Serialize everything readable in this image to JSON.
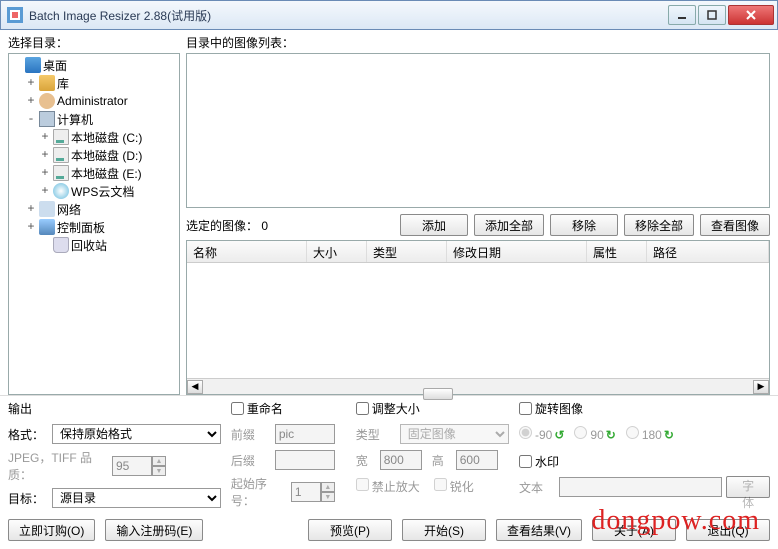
{
  "title": "Batch Image Resizer 2.88(试用版)",
  "labels": {
    "choose_dir": "选择目录：",
    "image_list": "目录中的图像列表：",
    "selected_images": "选定的图像：",
    "selected_count": "0",
    "output": "输出",
    "format": "格式：",
    "quality": "JPEG，TIFF 品质：",
    "target": "目标：",
    "rename": "重命名",
    "prefix": "前缀",
    "suffix": "后缀",
    "start_seq": "起始序号：",
    "resize": "调整大小",
    "type": "类型",
    "width": "宽",
    "height": "高",
    "no_enlarge": "禁止放大",
    "sharpen": "锐化",
    "rotate": "旋转图像",
    "watermark": "水印",
    "wm_text": "文本",
    "font": "字体"
  },
  "tree": {
    "n0": "桌面",
    "n1": "库",
    "n2": "Administrator",
    "n3": "计算机",
    "n3a": "本地磁盘 (C:)",
    "n3b": "本地磁盘 (D:)",
    "n3c": "本地磁盘 (E:)",
    "n3d": "WPS云文档",
    "n4": "网络",
    "n5": "控制面板",
    "n6": "回收站"
  },
  "buttons": {
    "add": "添加",
    "add_all": "添加全部",
    "remove": "移除",
    "remove_all": "移除全部",
    "view": "查看图像",
    "order_now": "立即订购(O)",
    "enter_reg": "输入注册码(E)",
    "preview": "预览(P)",
    "start": "开始(S)",
    "view_result": "查看结果(V)",
    "about": "关于(A)",
    "exit": "退出(Q)"
  },
  "columns": {
    "name": "名称",
    "size": "大小",
    "type": "类型",
    "modified": "修改日期",
    "attr": "属性",
    "path": "路径"
  },
  "values": {
    "format_select": "保持原始格式",
    "quality_val": "95",
    "target_select": "源目录",
    "prefix_val": "pic",
    "suffix_val": "",
    "seq_val": "1",
    "resize_type": "固定图像",
    "width_val": "800",
    "height_val": "600",
    "rot_m90": "-90",
    "rot_90": "90",
    "rot_180": "180",
    "wm_text_val": ""
  },
  "watermark_site": "dongpow.com"
}
